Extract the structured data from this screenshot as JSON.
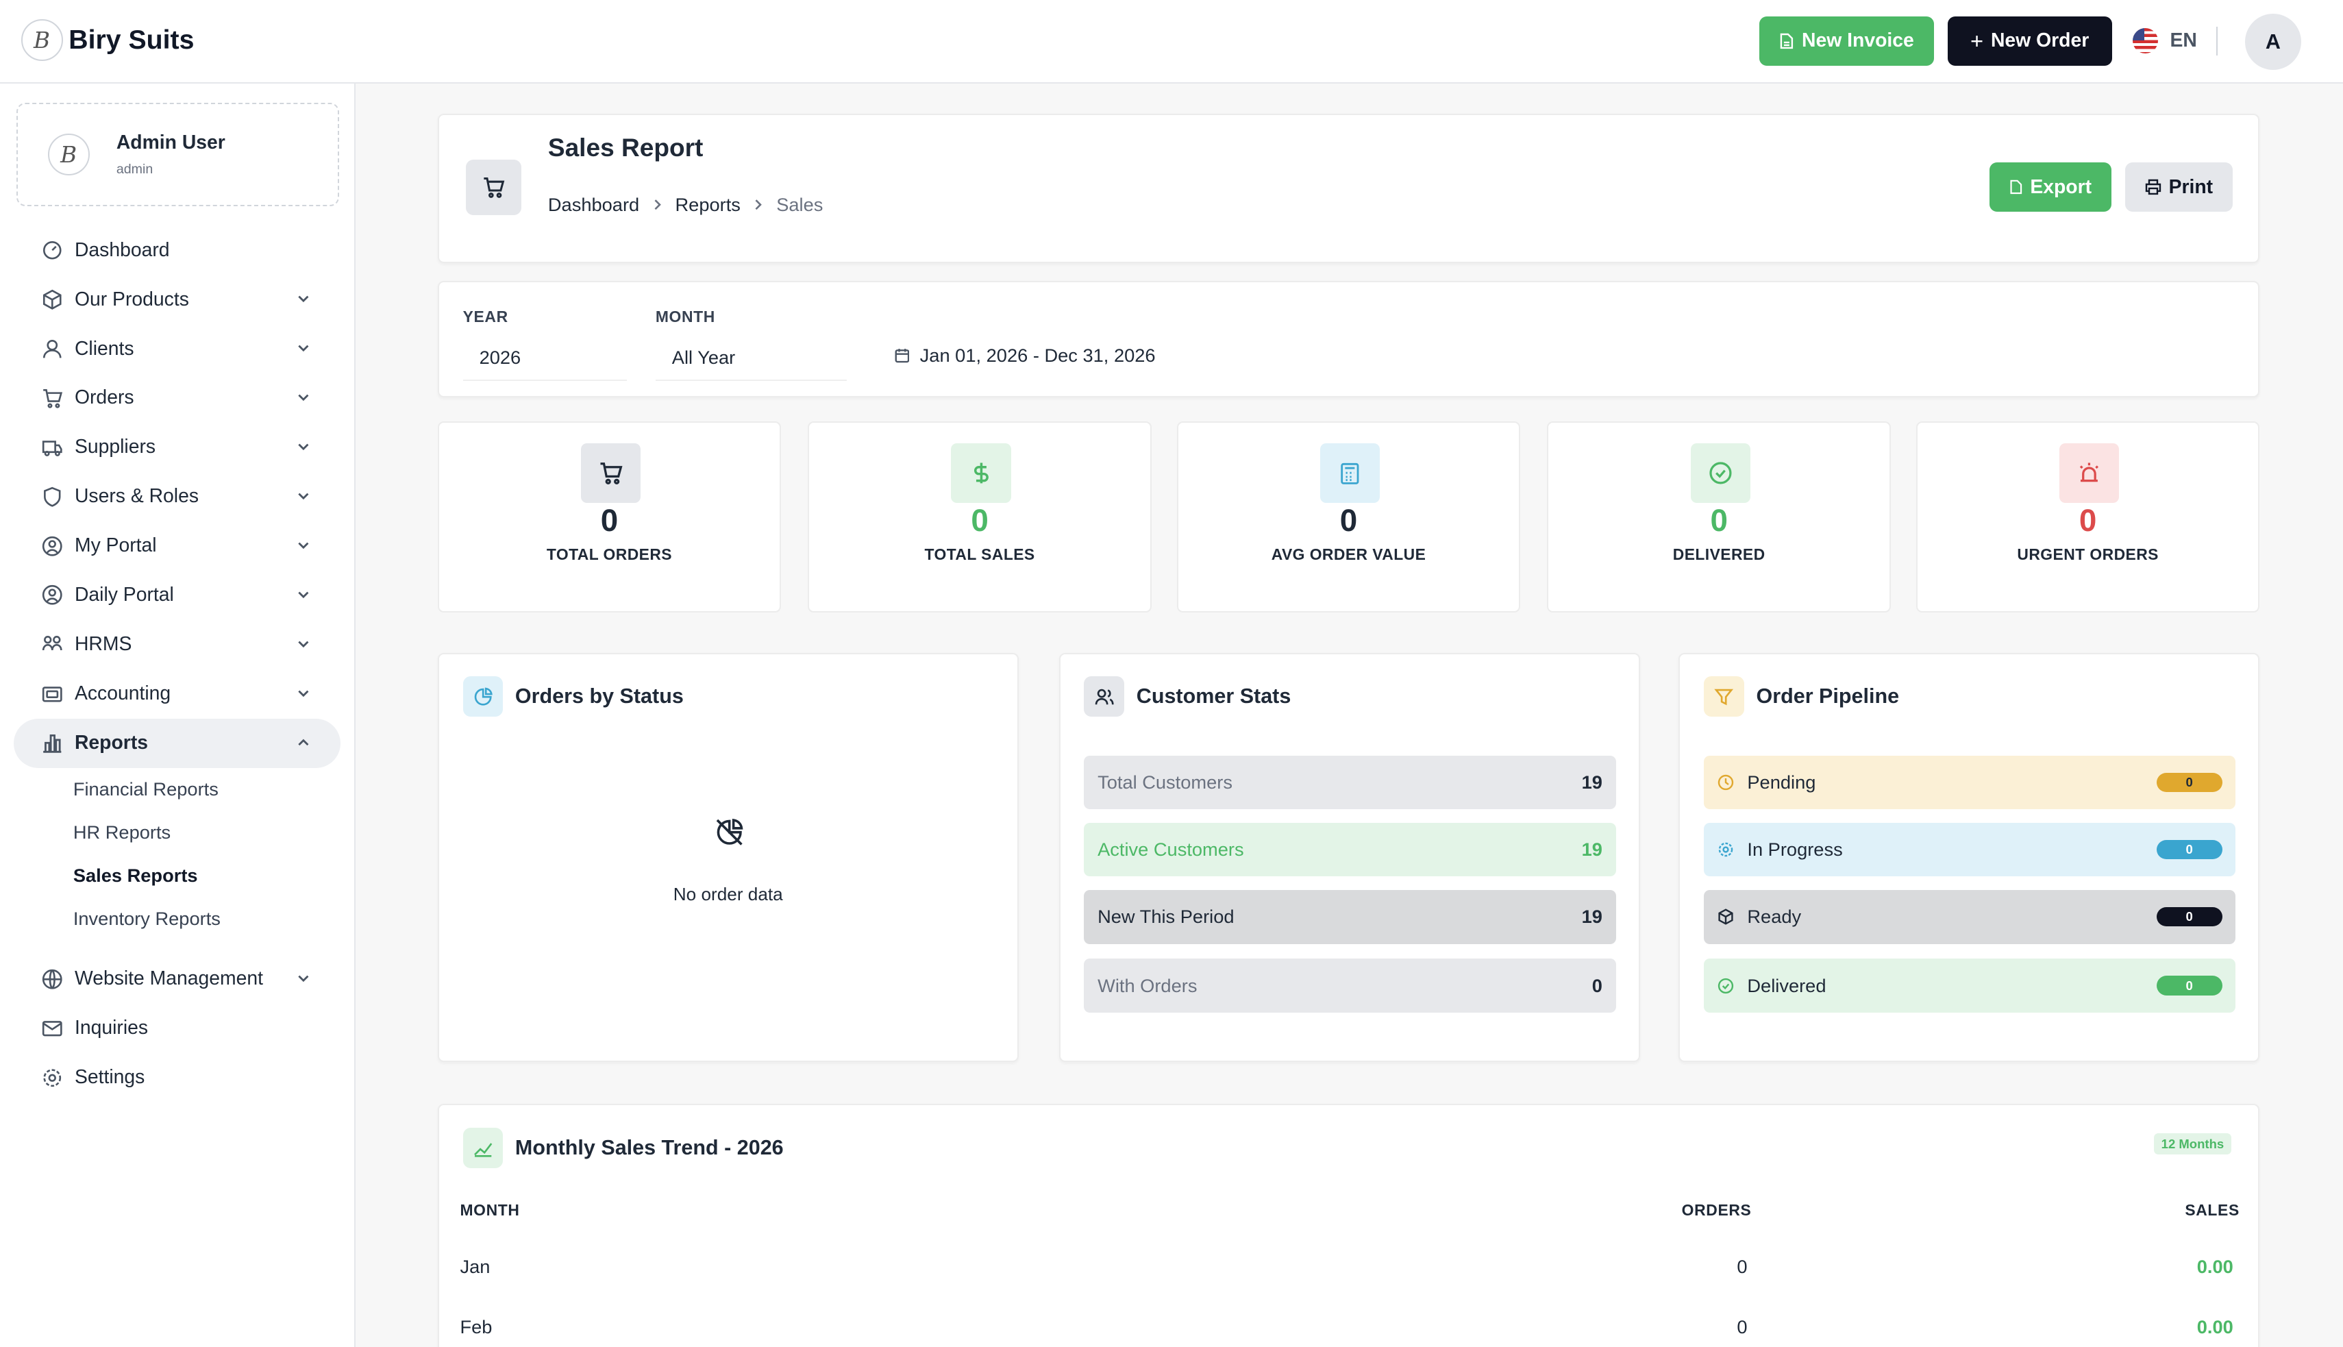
{
  "app": {
    "brand": "Biry Suits",
    "logo_letter": "B"
  },
  "topbar": {
    "new_invoice": "New Invoice",
    "new_order": "New Order",
    "lang": "EN",
    "avatar_letter": "A"
  },
  "user": {
    "name": "Admin User",
    "role": "admin"
  },
  "sidebar": {
    "items": [
      {
        "label": "Dashboard"
      },
      {
        "label": "Our Products"
      },
      {
        "label": "Clients"
      },
      {
        "label": "Orders"
      },
      {
        "label": "Suppliers"
      },
      {
        "label": "Users & Roles"
      },
      {
        "label": "My Portal"
      },
      {
        "label": "Daily Portal"
      },
      {
        "label": "HRMS"
      },
      {
        "label": "Accounting"
      },
      {
        "label": "Reports"
      },
      {
        "label": "Website Management"
      },
      {
        "label": "Inquiries"
      },
      {
        "label": "Settings"
      }
    ],
    "reports_sub": [
      {
        "label": "Financial Reports"
      },
      {
        "label": "HR Reports"
      },
      {
        "label": "Sales Reports"
      },
      {
        "label": "Inventory Reports"
      }
    ]
  },
  "page": {
    "title": "Sales Report",
    "breadcrumb": [
      "Dashboard",
      "Reports",
      "Sales"
    ],
    "export": "Export",
    "print": "Print"
  },
  "filters": {
    "year_label": "YEAR",
    "year_value": "2026",
    "month_label": "MONTH",
    "month_value": "All Year",
    "range": "Jan 01, 2026 - Dec 31, 2026"
  },
  "stats": [
    {
      "value": "0",
      "label": "TOTAL ORDERS",
      "color": "#1f2937"
    },
    {
      "value": "0",
      "label": "TOTAL SALES",
      "color": "#4cb866"
    },
    {
      "value": "0",
      "label": "AVG ORDER VALUE",
      "color": "#1f2937"
    },
    {
      "value": "0",
      "label": "DELIVERED",
      "color": "#4cb866"
    },
    {
      "value": "0",
      "label": "URGENT ORDERS",
      "color": "#dc4b4b"
    }
  ],
  "orders_by_status": {
    "title": "Orders by Status",
    "empty": "No order data"
  },
  "customer_stats": {
    "title": "Customer Stats",
    "rows": [
      {
        "label": "Total Customers",
        "value": "19"
      },
      {
        "label": "Active Customers",
        "value": "19"
      },
      {
        "label": "New This Period",
        "value": "19"
      },
      {
        "label": "With Orders",
        "value": "0"
      }
    ]
  },
  "pipeline": {
    "title": "Order Pipeline",
    "rows": [
      {
        "label": "Pending",
        "value": "0"
      },
      {
        "label": "In Progress",
        "value": "0"
      },
      {
        "label": "Ready",
        "value": "0"
      },
      {
        "label": "Delivered",
        "value": "0"
      }
    ]
  },
  "trend": {
    "title": "Monthly Sales Trend - 2026",
    "badge": "12 Months",
    "headers": {
      "month": "MONTH",
      "orders": "ORDERS",
      "sales": "SALES"
    },
    "rows": [
      {
        "month": "Jan",
        "orders": "0",
        "sales": "0.00"
      },
      {
        "month": "Feb",
        "orders": "0",
        "sales": "0.00"
      }
    ]
  }
}
